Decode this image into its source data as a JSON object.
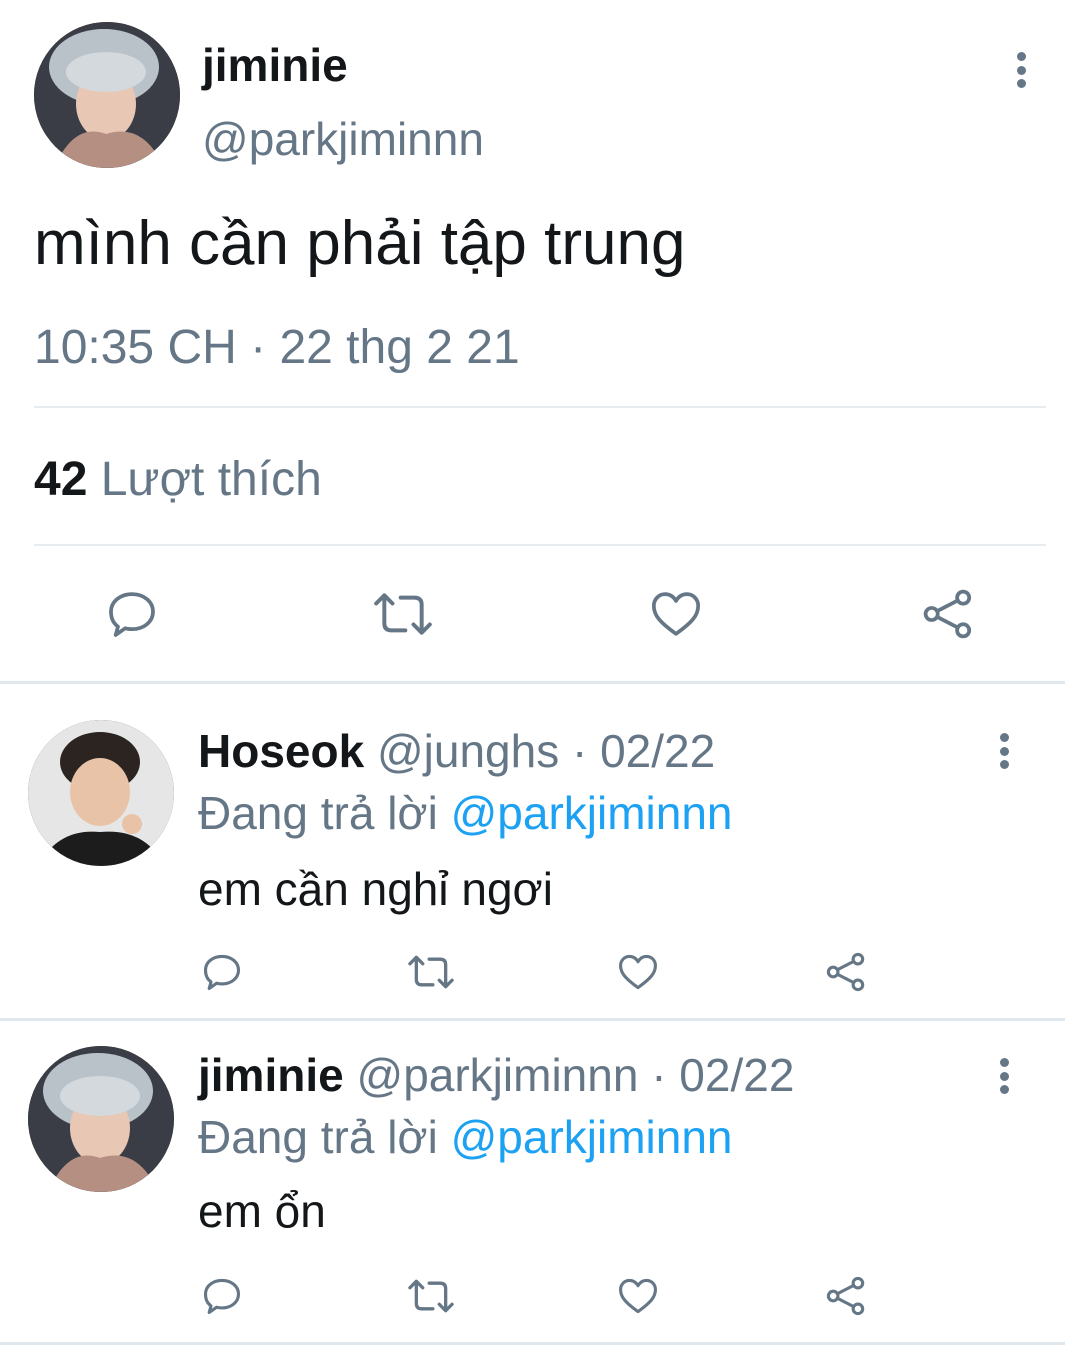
{
  "main_tweet": {
    "display_name": "jiminie",
    "handle": "@parkjiminnn",
    "text": "mình cần phải tập trung",
    "timestamp": "10:35 CH · 22 thg 2 21",
    "likes_count": "42",
    "likes_label": "Lượt thích"
  },
  "replies": [
    {
      "display_name": "Hoseok",
      "meta": "@junghs · 02/22",
      "replying_label": "Đang trả lời",
      "replying_to": "@parkjiminnn",
      "text": "em cần nghỉ ngơi"
    },
    {
      "display_name": "jiminie",
      "meta": "@parkjiminnn · 02/22",
      "replying_label": "Đang trả lời",
      "replying_to": "@parkjiminnn",
      "text": "em ổn"
    }
  ],
  "icons": [
    "reply-icon",
    "retweet-icon",
    "like-icon",
    "share-icon",
    "more-options-icon"
  ],
  "colors": {
    "text": "#14171a",
    "secondary": "#657786",
    "link": "#1da1f2",
    "divider": "#e6ecf0"
  }
}
